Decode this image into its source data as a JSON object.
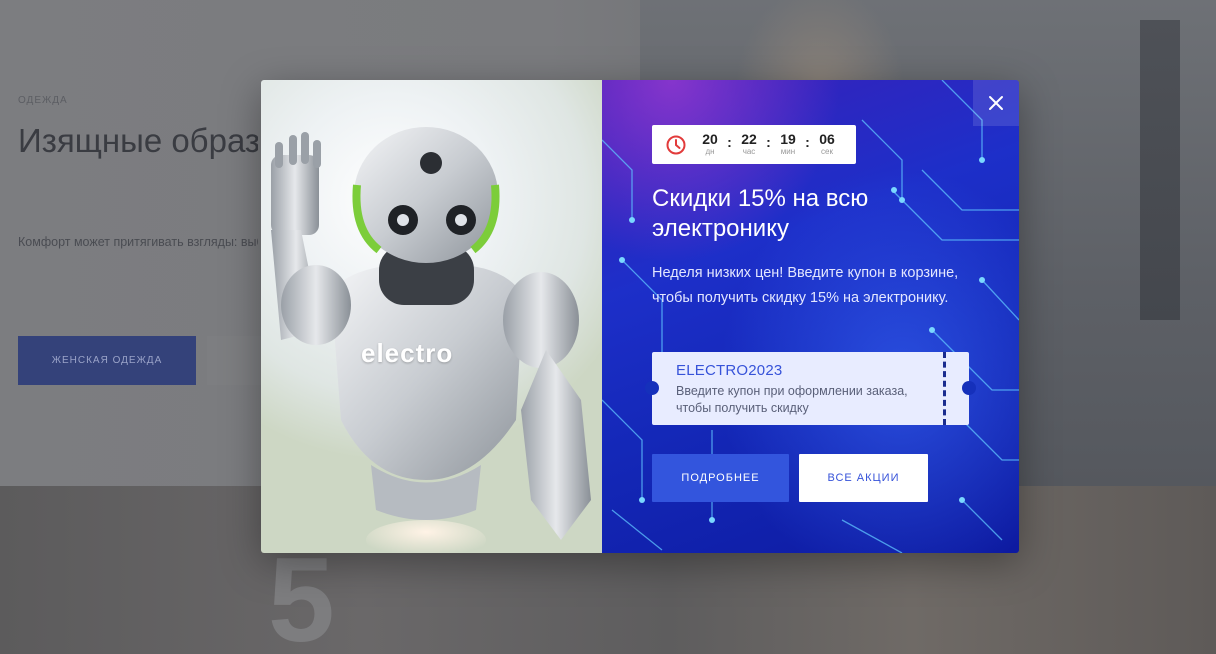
{
  "background_page": {
    "eyebrow": "ОДЕЖДА",
    "title": "Изящные образы на каждый день",
    "text": "Комфорт может притягивать взгляды: выберите удобную одежду для повседневной носки, футболки с принтами или бриджи",
    "primary_button": "ЖЕНСКАЯ ОДЕЖДА"
  },
  "modal": {
    "image_text": "electro",
    "close_icon": "close-icon",
    "timer": {
      "icon": "clock-icon",
      "units": [
        {
          "value": "20",
          "label": "дн"
        },
        {
          "value": "22",
          "label": "час"
        },
        {
          "value": "19",
          "label": "мин"
        },
        {
          "value": "06",
          "label": "сек"
        }
      ]
    },
    "title": "Скидки 15% на всю электронику",
    "description": "Неделя низких цен! Введите купон в корзине, чтобы получить скидку 15% на электронику.",
    "coupon": {
      "code": "ELECTRO2023",
      "note": "Введите купон при оформлении заказа, чтобы получить скидку"
    },
    "buttons": {
      "more": "ПОДРОБНЕЕ",
      "all": "ВСЕ АКЦИИ"
    }
  },
  "colors": {
    "accent_blue": "#3355dd",
    "coupon_bg": "#e8ecff",
    "timer_icon": "#e23b3b"
  }
}
